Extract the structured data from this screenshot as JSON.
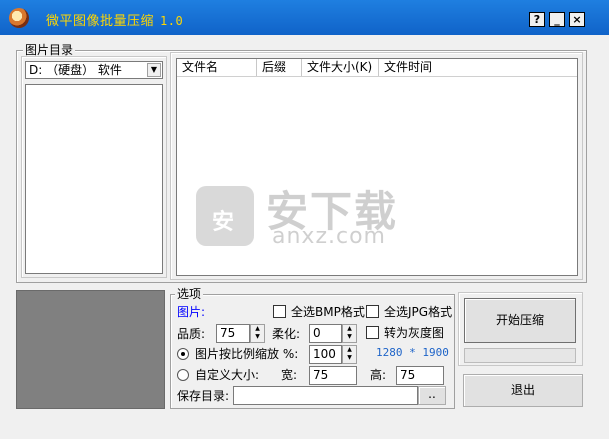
{
  "window": {
    "title": "微平图像批量压缩",
    "version": "1.0",
    "help_label": "?",
    "minimize_label": "_",
    "close_label": "×"
  },
  "left_panel": {
    "group_title": "图片目录",
    "drive_selected": "D: （硬盘） 软件"
  },
  "file_list": {
    "columns": [
      "文件名",
      "后缀",
      "文件大小(K)",
      "文件时间"
    ],
    "rows": []
  },
  "options": {
    "group_title": "选项",
    "image_label": "图片:",
    "select_all_bmp": "全选BMP格式",
    "select_all_jpg": "全选JPG格式",
    "quality_label": "品质:",
    "quality_value": "75",
    "smooth_label": "柔化:",
    "smooth_value": "0",
    "grayscale_label": "转为灰度图",
    "scale_label": "图片按比例缩放 %:",
    "scale_value": "100",
    "resolution": "1280 * 1900",
    "custom_label": "自定义大小:",
    "width_label": "宽:",
    "width_value": "75",
    "height_label": "高:",
    "height_value": "75",
    "save_dir_label": "保存目录:",
    "save_dir_value": "",
    "browse_label": ".."
  },
  "actions": {
    "start_label": "开始压缩",
    "exit_label": "退出",
    "progress": 0
  },
  "watermark": {
    "badge": "安",
    "cn": "安下载",
    "en": "anxz.com"
  }
}
